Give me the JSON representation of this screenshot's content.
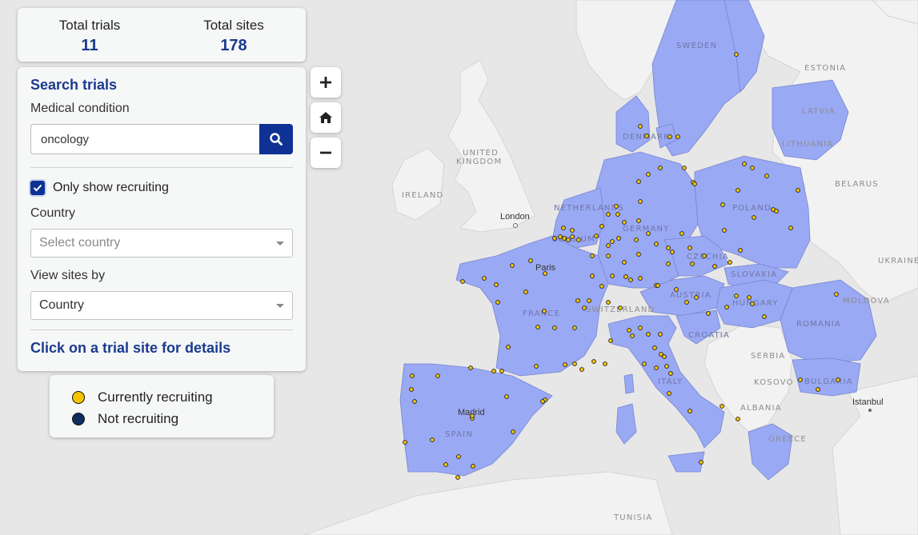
{
  "stats": {
    "total_trials_label": "Total trials",
    "total_trials_value": "11",
    "total_sites_label": "Total sites",
    "total_sites_value": "178"
  },
  "search": {
    "title": "Search trials",
    "condition_label": "Medical condition",
    "condition_value": "oncology",
    "recruiting_label": "Only show recruiting",
    "recruiting_checked": true,
    "country_label": "Country",
    "country_placeholder": "Select country",
    "view_by_label": "View sites by",
    "view_by_value": "Country",
    "footer_text": "Click on a trial site for details"
  },
  "legend": {
    "recruiting": "Currently recruiting",
    "not_recruiting": "Not recruiting",
    "recruiting_color": "#f5c400",
    "not_recruiting_color": "#0f2c5c"
  },
  "zoom": {
    "in_icon": "plus-icon",
    "home_icon": "home-icon",
    "out_icon": "minus-icon"
  },
  "map": {
    "eu_fill": "#9aa9f3",
    "non_eu_fill": "#f2f2f2",
    "water_fill": "#e7e7e7",
    "country_labels": {
      "sweden": "SWEDEN",
      "estonia": "ESTONIA",
      "latvia": "LATVIA",
      "lithuania": "LITHUANIA",
      "denmark": "DENMARK",
      "united_kingdom": "UNITED",
      "united_kingdom2": "KINGDOM",
      "ireland": "IRELAND",
      "belarus": "BELARUS",
      "netherlands": "NETHERLANDS",
      "poland": "POLAND",
      "germany": "GERMANY",
      "belgium": "BELGIUM",
      "czechia": "CZECHIA",
      "ukraine": "UKRAINE",
      "slovakia": "SLOVAKIA",
      "france": "FRANCE",
      "austria": "AUSTRIA",
      "hungary": "HUNGARY",
      "moldova": "MOLDOVA",
      "switzerland": "SWITZERLAND",
      "romania": "ROMANIA",
      "croatia": "CROATIA",
      "serbia": "SERBIA",
      "bulgaria": "BULGARIA",
      "italy": "ITALY",
      "kosovo": "KOSOVO",
      "albania": "ALBANIA",
      "spain": "SPAIN",
      "greece": "GREECE",
      "tunisia": "TUNISIA"
    },
    "cities": {
      "london": "London",
      "paris": "Paris",
      "madrid": "Madrid",
      "istanbul": "Istanbul"
    }
  }
}
